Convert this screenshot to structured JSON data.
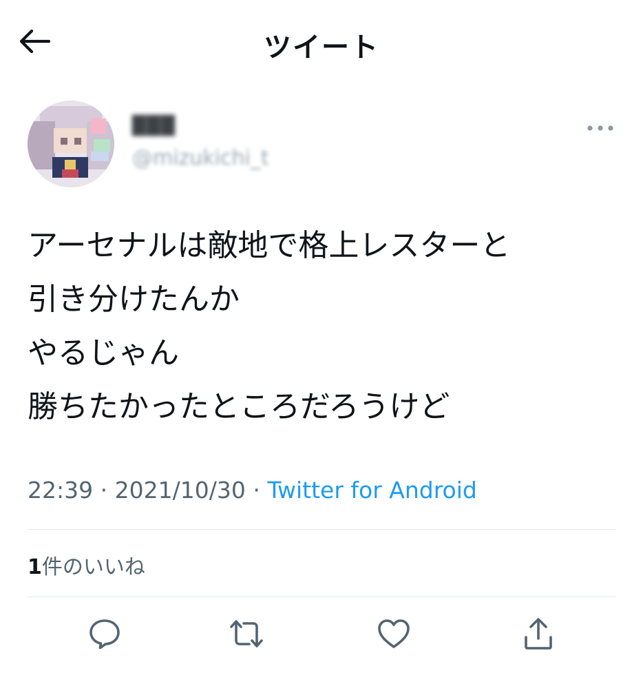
{
  "header": {
    "title": "ツイート",
    "back_icon": "arrow-left-icon"
  },
  "author": {
    "display_name": "███",
    "handle": "@mizukichi_t",
    "more_icon": "more-horizontal-icon"
  },
  "tweet": {
    "lines": [
      "アーセナルは敵地で格上レスターと",
      "引き分けたんか",
      "やるじゃん",
      "勝ちたかったところだろうけど"
    ],
    "time": "22:39",
    "separator": "·",
    "date": "2021/10/30",
    "source": "Twitter for Android"
  },
  "likes": {
    "count": "1",
    "label": "件のいいね"
  },
  "actions": [
    {
      "name": "reply",
      "icon": "comment-icon"
    },
    {
      "name": "retweet",
      "icon": "retweet-icon"
    },
    {
      "name": "like",
      "icon": "heart-icon"
    },
    {
      "name": "share",
      "icon": "share-icon"
    }
  ],
  "colors": {
    "text": "#0f1419",
    "secondary": "#536471",
    "link": "#1d9bf0",
    "divider": "#e1e8ed"
  }
}
